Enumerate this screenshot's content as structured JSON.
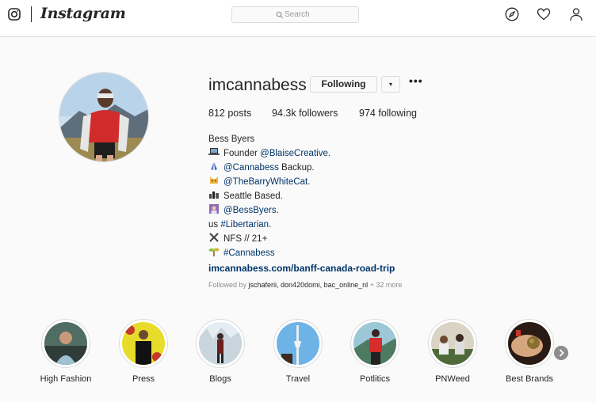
{
  "nav": {
    "logo_text": "Instagram",
    "search_placeholder": "Search",
    "icons": [
      "instagram-glyph-icon",
      "search-icon",
      "compass-icon",
      "heart-icon",
      "user-icon"
    ]
  },
  "profile": {
    "username": "imcannabess",
    "following_button": "Following",
    "dropdown_glyph": "▾",
    "more_glyph": "•••",
    "stats": {
      "posts_count": "812",
      "posts_label": "posts",
      "followers_count": "94.3k",
      "followers_label": "followers",
      "following_count": "974",
      "following_label": "following"
    },
    "bio": {
      "name": "Bess Byers",
      "line1_text": "Founder ",
      "line1_link": "@BlaiseCreative",
      "line1_after": ".",
      "line2_link": "@Cannabess",
      "line2_after": " Backup.",
      "line3_link": "@TheBarryWhiteCat",
      "line3_after": ".",
      "line4_text": "Seattle Based.",
      "line5_link": "@BessByers",
      "line5_after": ".",
      "line6_text": "us ",
      "line6_link": "#Libertarian",
      "line6_after": ".",
      "line7_text": "NFS // 21+",
      "line8_link": "#Cannabess",
      "url": "imcannabess.com/banff-canada-road-trip"
    },
    "followed_by": {
      "prefix": "Followed by ",
      "names": "jschaferii, don420domi, bac_online_nl",
      "suffix": " + 32 more"
    }
  },
  "highlights": [
    {
      "label": "High Fashion"
    },
    {
      "label": "Press"
    },
    {
      "label": "Blogs"
    },
    {
      "label": "Travel"
    },
    {
      "label": "Potlitics"
    },
    {
      "label": "PNWeed"
    },
    {
      "label": "Best Brands"
    }
  ],
  "colors": {
    "text": "#262626",
    "link": "#003569",
    "muted": "#8e8e8e",
    "border": "#dbdbdb",
    "background": "#fafafa"
  }
}
